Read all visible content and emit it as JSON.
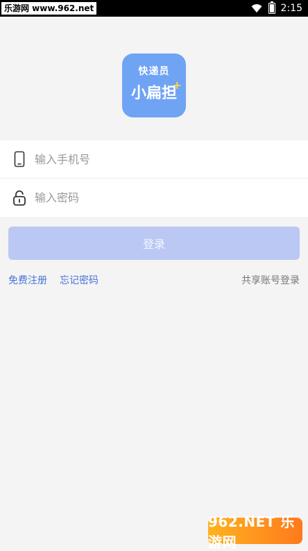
{
  "status_bar": {
    "watermark": "乐游网 www.962.net",
    "time": "2:15"
  },
  "logo": {
    "line1": "快递员",
    "line2": "小扁担",
    "plus": "+"
  },
  "form": {
    "phone_placeholder": "输入手机号",
    "password_placeholder": "输入密码"
  },
  "actions": {
    "login": "登录",
    "register": "免费注册",
    "forgot": "忘记密码",
    "shared_login": "共享账号登录"
  },
  "watermark_bottom": "962.NET 乐游网",
  "colors": {
    "logo_bg": "#6fa3f4",
    "button_bg": "#bac8f3",
    "link_blue": "#4a72d6"
  }
}
